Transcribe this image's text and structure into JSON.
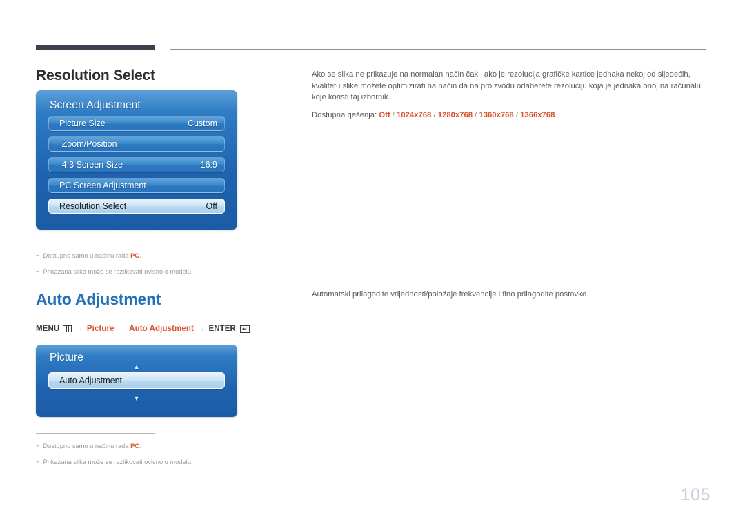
{
  "page": {
    "number": "105"
  },
  "sections": [
    {
      "heading": "Resolution Select",
      "body": "Ako se slika ne prikazuje na normalan način čak i ako je rezolucija grafičke kartice jednaka nekoj od sljedećih, kvalitetu slike možete optimizirati na način da na proizvodu odaberete rezoluciju koja je jednaka onoj na računalu koje koristi taj izbornik.",
      "available_label": "Dostupna rješenja:",
      "available_options": [
        "Off",
        "1024x768",
        "1280x768",
        "1360x768",
        "1366x768"
      ]
    },
    {
      "heading": "Auto Adjustment",
      "body": "Automatski prilagodite vrijednosti/položaje frekvencije i fino prilagodite postavke."
    }
  ],
  "breadcrumb": {
    "menu_label": "MENU",
    "menu_icon": "menu-grid-icon",
    "arrow": "→",
    "steps": [
      "Picture",
      "Auto Adjustment"
    ],
    "enter_label": "ENTER",
    "enter_icon": "enter-return-icon",
    "enter_glyph": "↵"
  },
  "osd_screen_adjustment": {
    "title": "Screen Adjustment",
    "rows": [
      {
        "label": "Picture Size",
        "value": "Custom",
        "bullet": "",
        "selected": false
      },
      {
        "label": "Zoom/Position",
        "value": "",
        "bullet": "·",
        "selected": false
      },
      {
        "label": "4:3 Screen Size",
        "value": "16:9",
        "bullet": "·",
        "selected": false
      },
      {
        "label": "PC Screen Adjustment",
        "value": "",
        "bullet": "",
        "selected": false
      },
      {
        "label": "Resolution Select",
        "value": "Off",
        "bullet": "",
        "selected": true
      }
    ]
  },
  "osd_picture": {
    "title": "Picture",
    "chevron_up": "▲",
    "chevron_down": "▼",
    "rows": [
      {
        "label": "Auto Adjustment",
        "value": "",
        "bullet": "",
        "selected": true
      }
    ]
  },
  "footnotes": [
    {
      "dash": "−",
      "text_before": "Dostupno samo u načinu rada ",
      "highlight": "PC",
      "text_after": "."
    },
    {
      "dash": "−",
      "text_before": "Prikazana slika može se razlikovati ovisno o modelu.",
      "highlight": "",
      "text_after": ""
    }
  ],
  "colors": {
    "accent_orange": "#d6532b",
    "heading_blue": "#2372b9",
    "osd_blue": "#1f63ae",
    "page_number": "#c9cdda"
  }
}
